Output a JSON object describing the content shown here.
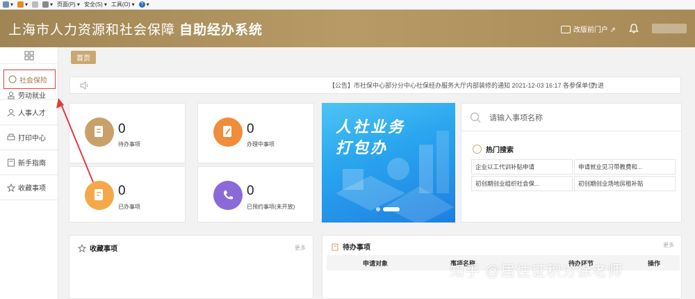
{
  "browser_toolbar": {
    "items": [
      "页面(P) ▾",
      "安全(S) ▾",
      "工具(O) ▾"
    ]
  },
  "header": {
    "title_main": "上海市人力资源和社会保障",
    "title_bold": "自助经办系统",
    "portal_link": "改版前门户"
  },
  "sidebar": {
    "items": [
      {
        "label": "社会保险",
        "icon": "social-insurance-icon"
      },
      {
        "label": "劳动就业",
        "icon": "employment-icon"
      },
      {
        "label": "人事人才",
        "icon": "talent-icon"
      },
      {
        "label": "打印中心",
        "icon": "printer-icon"
      },
      {
        "label": "新手指南",
        "icon": "guide-icon"
      },
      {
        "label": "收藏事项",
        "icon": "star-icon"
      }
    ]
  },
  "tabs": {
    "home": "首页"
  },
  "notice": {
    "text": "【公告】市社保中心部分分中心社保经办服务大厅内部装修的通知 2021-12-03 16:17 各参保单位:",
    "extra": "为进"
  },
  "stats": [
    {
      "value": "0",
      "label": "待办事项",
      "color": "#c9a06a"
    },
    {
      "value": "0",
      "label": "办理中事项",
      "color": "#f08c3a"
    },
    {
      "value": "0",
      "label": "已办事项",
      "color": "#f5a84a"
    },
    {
      "value": "0",
      "label": "已预约事项(未开放)",
      "color": "#8b6ad8"
    }
  ],
  "banner": {
    "line1": "人社业务",
    "line2": "打包办"
  },
  "search": {
    "placeholder": "请输入事项名称",
    "hot_title": "热门搜索",
    "hot_items": [
      "企业以工代训补贴申请",
      "申请就业见习带教费和...",
      "初创期创业组织社会保...",
      "初创期创业场地房租补贴"
    ]
  },
  "favorites": {
    "title": "收藏事项",
    "more": "更多"
  },
  "todo": {
    "title": "待办事项",
    "more": "更多",
    "columns": [
      "申请对象",
      "事项名称",
      "待办环节",
      "操作"
    ]
  },
  "watermark": "知乎 @居住证积分徐老师"
}
